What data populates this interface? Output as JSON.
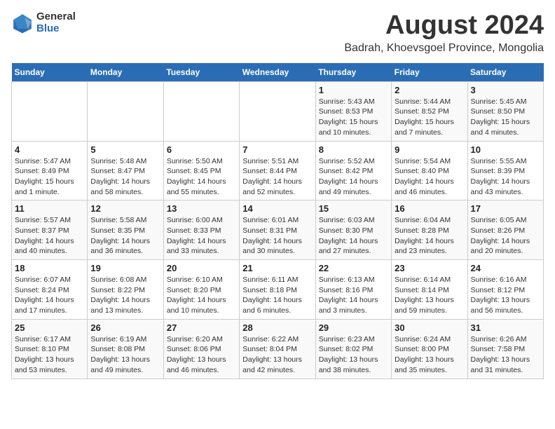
{
  "logo": {
    "general": "General",
    "blue": "Blue"
  },
  "title": "August 2024",
  "subtitle": "Badrah, Khoevsgoel Province, Mongolia",
  "days_of_week": [
    "Sunday",
    "Monday",
    "Tuesday",
    "Wednesday",
    "Thursday",
    "Friday",
    "Saturday"
  ],
  "weeks": [
    [
      {
        "day": "",
        "info": ""
      },
      {
        "day": "",
        "info": ""
      },
      {
        "day": "",
        "info": ""
      },
      {
        "day": "",
        "info": ""
      },
      {
        "day": "1",
        "info": "Sunrise: 5:43 AM\nSunset: 8:53 PM\nDaylight: 15 hours and 10 minutes."
      },
      {
        "day": "2",
        "info": "Sunrise: 5:44 AM\nSunset: 8:52 PM\nDaylight: 15 hours and 7 minutes."
      },
      {
        "day": "3",
        "info": "Sunrise: 5:45 AM\nSunset: 8:50 PM\nDaylight: 15 hours and 4 minutes."
      }
    ],
    [
      {
        "day": "4",
        "info": "Sunrise: 5:47 AM\nSunset: 8:49 PM\nDaylight: 15 hours and 1 minute."
      },
      {
        "day": "5",
        "info": "Sunrise: 5:48 AM\nSunset: 8:47 PM\nDaylight: 14 hours and 58 minutes."
      },
      {
        "day": "6",
        "info": "Sunrise: 5:50 AM\nSunset: 8:45 PM\nDaylight: 14 hours and 55 minutes."
      },
      {
        "day": "7",
        "info": "Sunrise: 5:51 AM\nSunset: 8:44 PM\nDaylight: 14 hours and 52 minutes."
      },
      {
        "day": "8",
        "info": "Sunrise: 5:52 AM\nSunset: 8:42 PM\nDaylight: 14 hours and 49 minutes."
      },
      {
        "day": "9",
        "info": "Sunrise: 5:54 AM\nSunset: 8:40 PM\nDaylight: 14 hours and 46 minutes."
      },
      {
        "day": "10",
        "info": "Sunrise: 5:55 AM\nSunset: 8:39 PM\nDaylight: 14 hours and 43 minutes."
      }
    ],
    [
      {
        "day": "11",
        "info": "Sunrise: 5:57 AM\nSunset: 8:37 PM\nDaylight: 14 hours and 40 minutes."
      },
      {
        "day": "12",
        "info": "Sunrise: 5:58 AM\nSunset: 8:35 PM\nDaylight: 14 hours and 36 minutes."
      },
      {
        "day": "13",
        "info": "Sunrise: 6:00 AM\nSunset: 8:33 PM\nDaylight: 14 hours and 33 minutes."
      },
      {
        "day": "14",
        "info": "Sunrise: 6:01 AM\nSunset: 8:31 PM\nDaylight: 14 hours and 30 minutes."
      },
      {
        "day": "15",
        "info": "Sunrise: 6:03 AM\nSunset: 8:30 PM\nDaylight: 14 hours and 27 minutes."
      },
      {
        "day": "16",
        "info": "Sunrise: 6:04 AM\nSunset: 8:28 PM\nDaylight: 14 hours and 23 minutes."
      },
      {
        "day": "17",
        "info": "Sunrise: 6:05 AM\nSunset: 8:26 PM\nDaylight: 14 hours and 20 minutes."
      }
    ],
    [
      {
        "day": "18",
        "info": "Sunrise: 6:07 AM\nSunset: 8:24 PM\nDaylight: 14 hours and 17 minutes."
      },
      {
        "day": "19",
        "info": "Sunrise: 6:08 AM\nSunset: 8:22 PM\nDaylight: 14 hours and 13 minutes."
      },
      {
        "day": "20",
        "info": "Sunrise: 6:10 AM\nSunset: 8:20 PM\nDaylight: 14 hours and 10 minutes."
      },
      {
        "day": "21",
        "info": "Sunrise: 6:11 AM\nSunset: 8:18 PM\nDaylight: 14 hours and 6 minutes."
      },
      {
        "day": "22",
        "info": "Sunrise: 6:13 AM\nSunset: 8:16 PM\nDaylight: 14 hours and 3 minutes."
      },
      {
        "day": "23",
        "info": "Sunrise: 6:14 AM\nSunset: 8:14 PM\nDaylight: 13 hours and 59 minutes."
      },
      {
        "day": "24",
        "info": "Sunrise: 6:16 AM\nSunset: 8:12 PM\nDaylight: 13 hours and 56 minutes."
      }
    ],
    [
      {
        "day": "25",
        "info": "Sunrise: 6:17 AM\nSunset: 8:10 PM\nDaylight: 13 hours and 53 minutes."
      },
      {
        "day": "26",
        "info": "Sunrise: 6:19 AM\nSunset: 8:08 PM\nDaylight: 13 hours and 49 minutes."
      },
      {
        "day": "27",
        "info": "Sunrise: 6:20 AM\nSunset: 8:06 PM\nDaylight: 13 hours and 46 minutes."
      },
      {
        "day": "28",
        "info": "Sunrise: 6:22 AM\nSunset: 8:04 PM\nDaylight: 13 hours and 42 minutes."
      },
      {
        "day": "29",
        "info": "Sunrise: 6:23 AM\nSunset: 8:02 PM\nDaylight: 13 hours and 38 minutes."
      },
      {
        "day": "30",
        "info": "Sunrise: 6:24 AM\nSunset: 8:00 PM\nDaylight: 13 hours and 35 minutes."
      },
      {
        "day": "31",
        "info": "Sunrise: 6:26 AM\nSunset: 7:58 PM\nDaylight: 13 hours and 31 minutes."
      }
    ]
  ]
}
